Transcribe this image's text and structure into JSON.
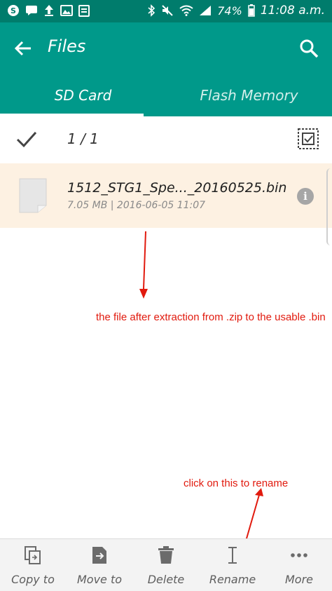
{
  "status_bar": {
    "battery": "74%",
    "time": "11:08 a.m."
  },
  "app_bar": {
    "title": "Files"
  },
  "tabs": [
    {
      "label": "SD Card",
      "selected": true
    },
    {
      "label": "Flash Memory",
      "selected": false
    }
  ],
  "selection": {
    "count": "1 / 1"
  },
  "file": {
    "name": "1512_STG1_Spe..._20160525.bin",
    "meta": "7.05 MB | 2016-06-05 11:07"
  },
  "annotations": [
    "the file after extraction from .zip to the usable .bin",
    "click on this to rename"
  ],
  "bottom_actions": [
    {
      "label": "Copy to",
      "icon": "copy-icon"
    },
    {
      "label": "Move to",
      "icon": "move-icon"
    },
    {
      "label": "Delete",
      "icon": "trash-icon"
    },
    {
      "label": "Rename",
      "icon": "rename-cursor-icon"
    },
    {
      "label": "More",
      "icon": "more-icon"
    }
  ],
  "colors": {
    "status_bar": "#007c6c",
    "app_bar": "#00998a",
    "selected_row": "#fdf1e2",
    "annotation": "#e11a0e"
  }
}
